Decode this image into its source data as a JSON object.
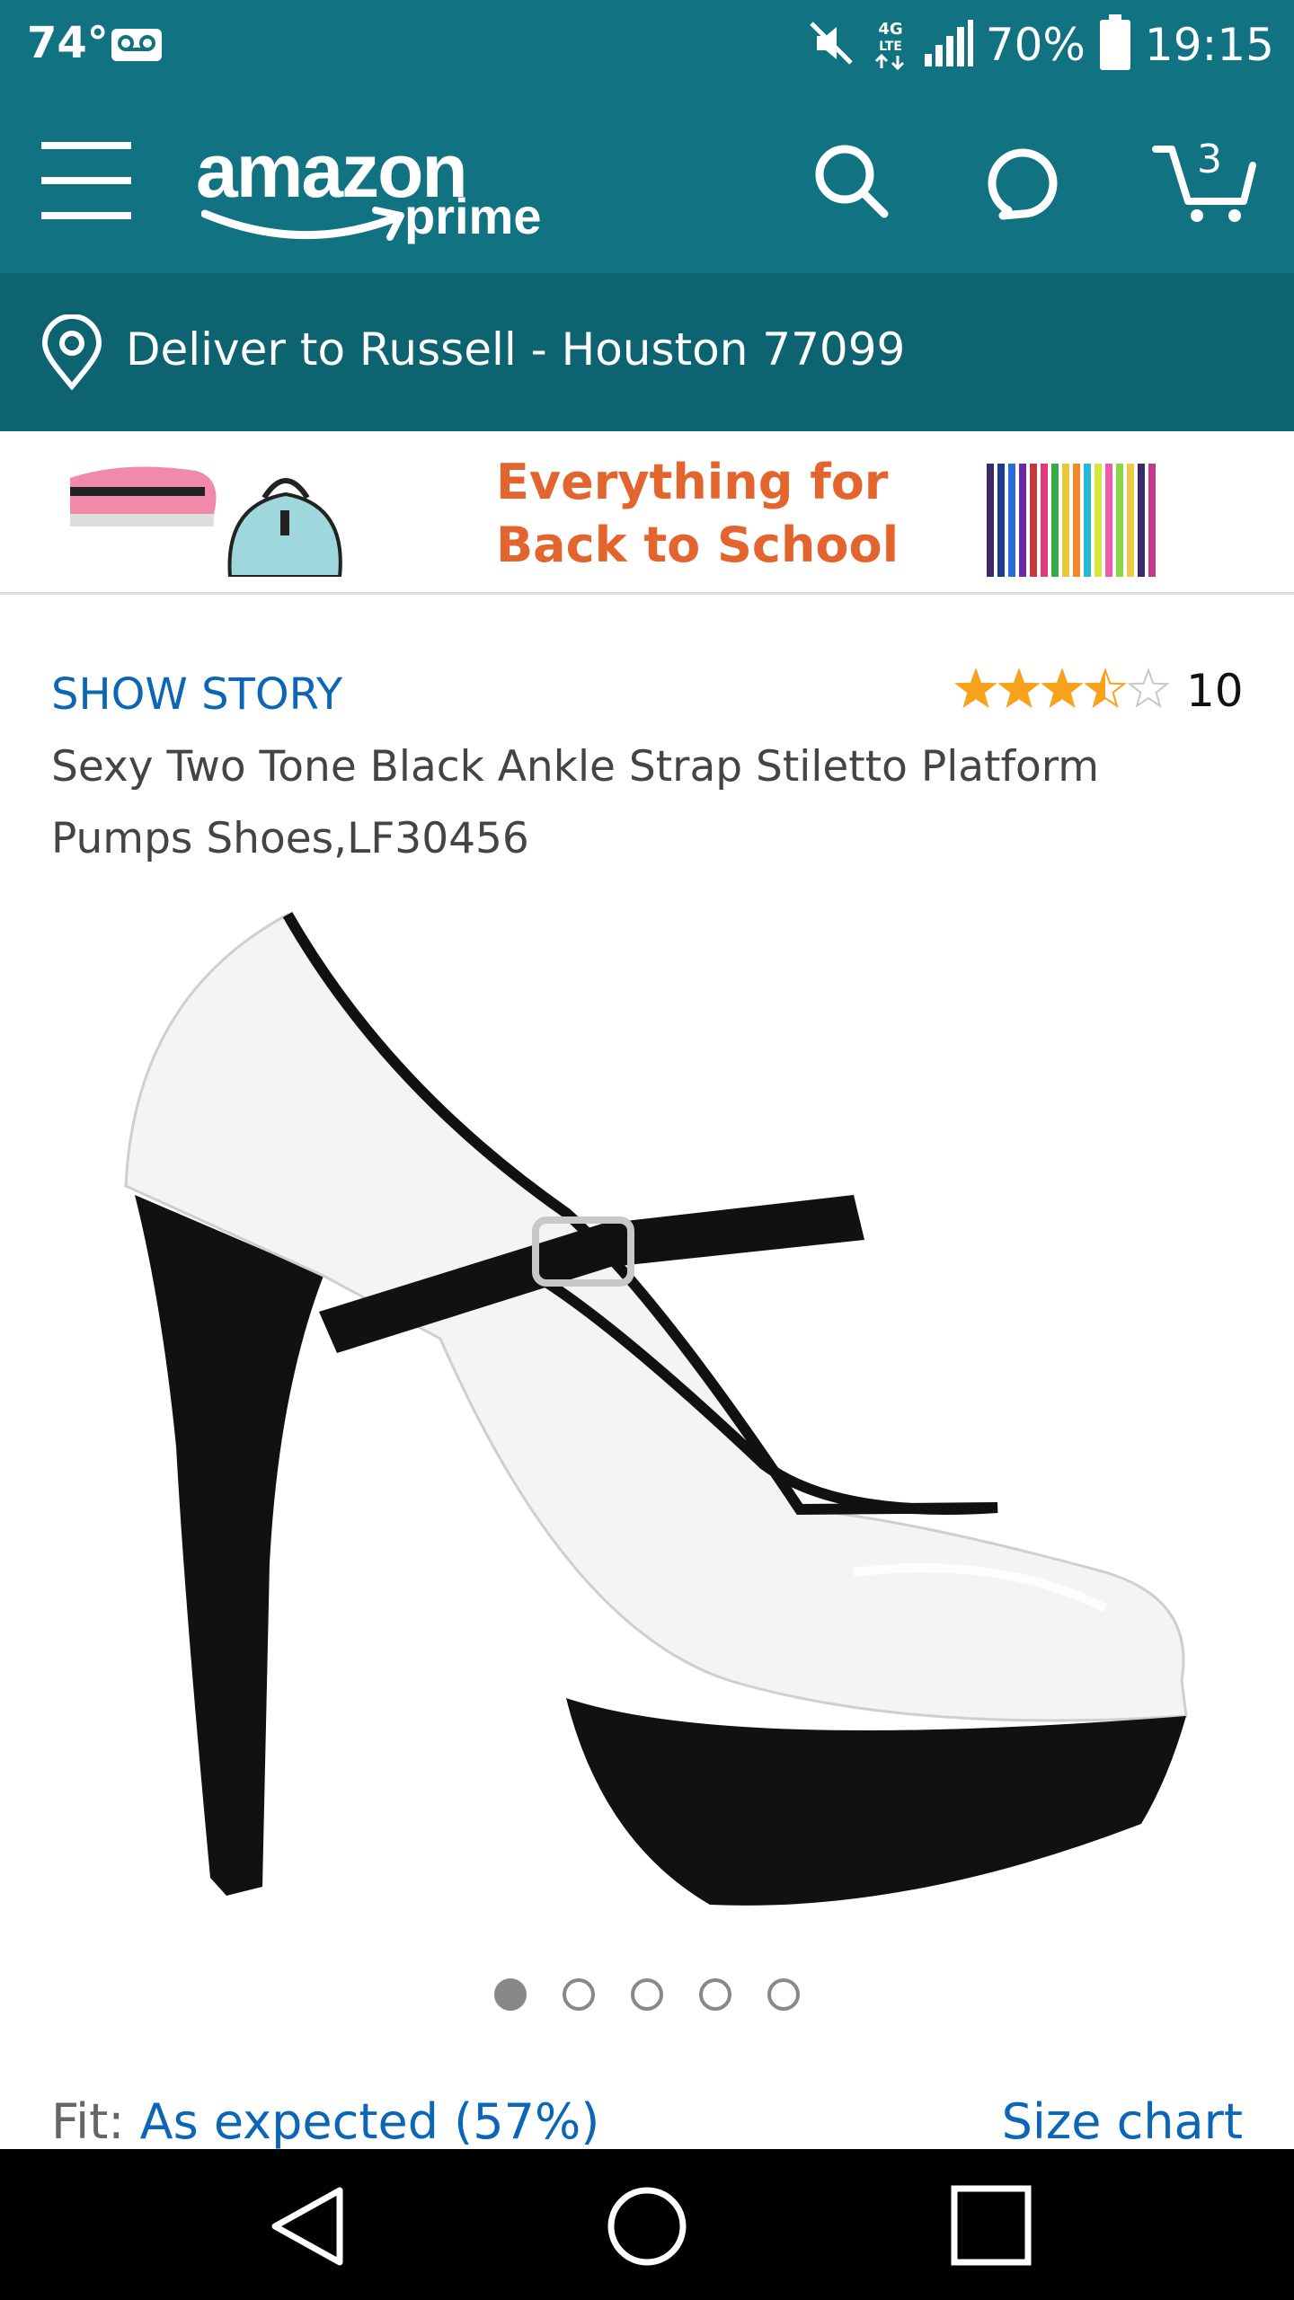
{
  "status_bar": {
    "temperature": "74°",
    "network": "4G LTE",
    "battery": "70%",
    "time": "19:15"
  },
  "header": {
    "logo_word": "amazon",
    "logo_sub": "prime",
    "cart_count": "3"
  },
  "delivery": {
    "text": "Deliver to Russell - Houston 77099"
  },
  "banner": {
    "line1": "Everything for",
    "line2": "Back to School"
  },
  "product": {
    "show_story": "SHOW STORY",
    "rating_stars": 3.5,
    "rating_count": "10",
    "title": "Sexy Two Tone Black Ankle Strap Stiletto Platform Pumps Shoes,LF30456",
    "image_count": 5,
    "active_image": 1
  },
  "fit": {
    "label": "Fit: ",
    "value": "As expected (57%)",
    "size_chart": "Size chart"
  },
  "colors": {
    "header_teal": "#117281",
    "deliver_teal": "#0d6370",
    "link_blue": "#0b66b7",
    "star_orange": "#f7a21b",
    "banner_orange": "#e4642e"
  }
}
